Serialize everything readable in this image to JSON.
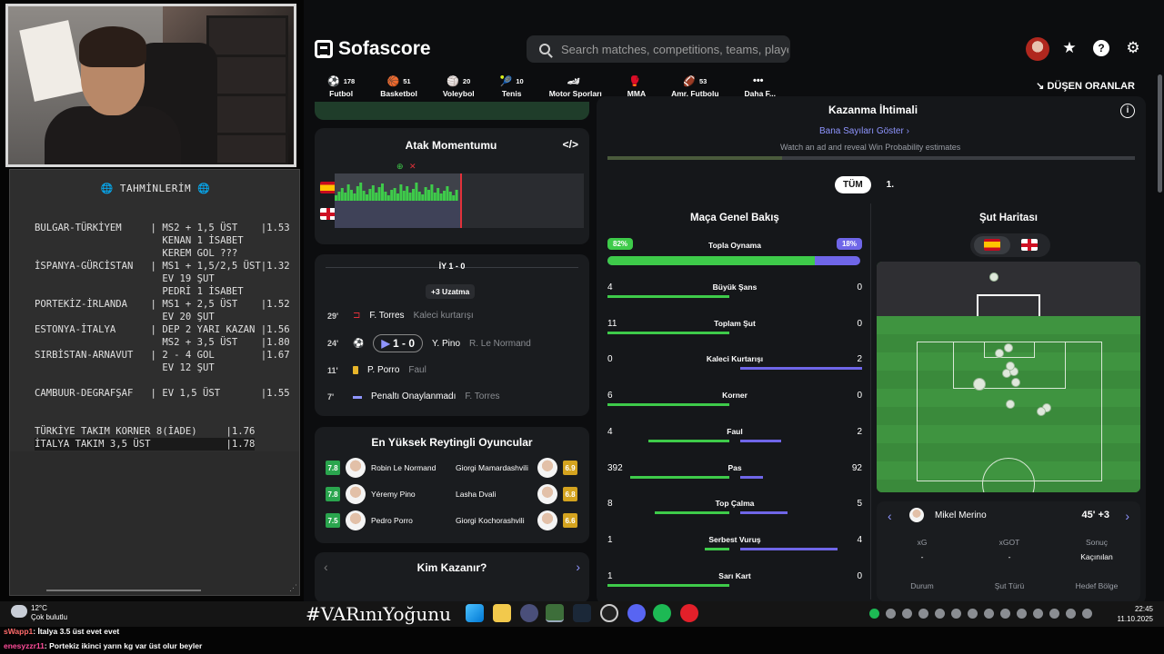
{
  "notepad": {
    "title": "🌐 TAHMİNLERİM 🌐",
    "rows": [
      "BULGAR-TÜRKİYEM     | MS2 + 1,5 ÜST    |1.53",
      "                      KENAN 1 İSABET",
      "                      KEREM GOL ???",
      "İSPANYA-GÜRCİSTAN   | MS1 + 1,5/2,5 ÜST|1.32",
      "                      EV 19 ŞUT",
      "                      PEDRİ 1 İSABET",
      "PORTEKİZ-İRLANDA    | MS1 + 2,5 ÜST    |1.52",
      "                      EV 20 ŞUT",
      "ESTONYA-İTALYA      | DEP 2 YARI KAZAN |1.56",
      "                      MS2 + 3,5 ÜST    |1.80",
      "SIRBİSTAN-ARNAVUT   | 2 - 4 GOL        |1.67",
      "                      EV 12 ŞUT",
      "",
      "CAMBUUR-DEGRAFŞAF   | EV 1,5 ÜST       |1.55",
      "",
      "",
      "TÜRKİYE TAKIM KORNER 8(İADE)     |1.76",
      "İTALYA TAKIM 3,5 ÜST             |1.78"
    ]
  },
  "sofa": {
    "logo": "Sofascore",
    "search_placeholder": "Search matches, competitions, teams, playe...",
    "sports": [
      {
        "label": "Futbol",
        "count": "178",
        "icon": "⚽"
      },
      {
        "label": "Basketbol",
        "count": "51",
        "icon": "🏀"
      },
      {
        "label": "Voleybol",
        "count": "20",
        "icon": "🏐"
      },
      {
        "label": "Tenis",
        "count": "10",
        "icon": "🎾"
      },
      {
        "label": "Motor Sporları",
        "count": "",
        "icon": "🏎"
      },
      {
        "label": "MMA",
        "count": "",
        "icon": "🥊"
      },
      {
        "label": "Amr. Futbolu",
        "count": "53",
        "icon": "🏈"
      },
      {
        "label": "Daha F...",
        "count": "",
        "icon": "•••"
      }
    ],
    "falling_odds": "DÜŞEN ORANLAR",
    "momentum_title": "Atak Momentumu",
    "ht_label": "İY 1 - 0",
    "added_time": "+3 Uzatma",
    "events": [
      {
        "min": "29'",
        "name": "F. Torres",
        "detail": "Kaleci kurtarışı"
      },
      {
        "min": "24'",
        "score": "1 - 0",
        "name": "Y. Pino",
        "detail": "R. Le Normand"
      },
      {
        "min": "11'",
        "name": "P. Porro",
        "detail": "Faul"
      },
      {
        "min": "7'",
        "name": "Penaltı Onaylanmadı",
        "detail": "F. Torres"
      }
    ],
    "top_players_title": "En Yüksek Reytingli Oyuncular",
    "players_left": [
      {
        "rating": "7.8",
        "name": "Robin Le Normand"
      },
      {
        "rating": "7.8",
        "name": "Yéremy Pino"
      },
      {
        "rating": "7.5",
        "name": "Pedro Porro"
      }
    ],
    "players_right": [
      {
        "rating": "6.9",
        "name": "Giorgi Mamardashvili"
      },
      {
        "rating": "6.8",
        "name": "Lasha Dvali"
      },
      {
        "rating": "6.6",
        "name": "Giorgi Kochorashvili"
      }
    ],
    "who_wins": "Kim Kazanır?",
    "win_prob_title": "Kazanma İhtimali",
    "win_prob_link": "Bana Sayıları Göster",
    "win_prob_note": "Watch an ad and reveal Win Probability estimates",
    "tabs": [
      "TÜM",
      "1."
    ],
    "overview_title": "Maça Genel Bakış",
    "possession": {
      "label": "Topla Oynama",
      "home": "82%",
      "away": "18%",
      "home_pct": 82
    },
    "stats": [
      {
        "label": "Büyük Şans",
        "home": "4",
        "away": "0"
      },
      {
        "label": "Toplam Şut",
        "home": "11",
        "away": "0"
      },
      {
        "label": "Kaleci Kurtarışı",
        "home": "0",
        "away": "2"
      },
      {
        "label": "Korner",
        "home": "6",
        "away": "0"
      },
      {
        "label": "Faul",
        "home": "4",
        "away": "2"
      },
      {
        "label": "Pas",
        "home": "392",
        "away": "92"
      },
      {
        "label": "Top Çalma",
        "home": "8",
        "away": "5"
      },
      {
        "label": "Serbest Vuruş",
        "home": "1",
        "away": "4"
      },
      {
        "label": "Sarı Kart",
        "home": "1",
        "away": "0"
      }
    ],
    "shotmap_title": "Şut Haritası",
    "shot_player": "Mikel Merino",
    "shot_time": "45' +3",
    "shot_cols": [
      {
        "label": "xG",
        "value": "-"
      },
      {
        "label": "xGOT",
        "value": "-"
      },
      {
        "label": "Sonuç",
        "value": "Kaçınılan"
      }
    ],
    "shot_cols2": [
      "Durum",
      "Şut Türü",
      "Hedef Bölge"
    ]
  },
  "taskbar": {
    "temp": "12°C",
    "weather": "Çok bulutlu",
    "hashtag": "#VARınıYoğunu",
    "time": "22:45",
    "date": "11.10.2025"
  },
  "chat": [
    {
      "user": "sWapp1",
      "msg": ": İtalya 3.5 üst evet evet"
    },
    {
      "user": "enesyzzr11",
      "msg": ": Portekiz ikinci yarın kg var üst olur beyler"
    }
  ]
}
